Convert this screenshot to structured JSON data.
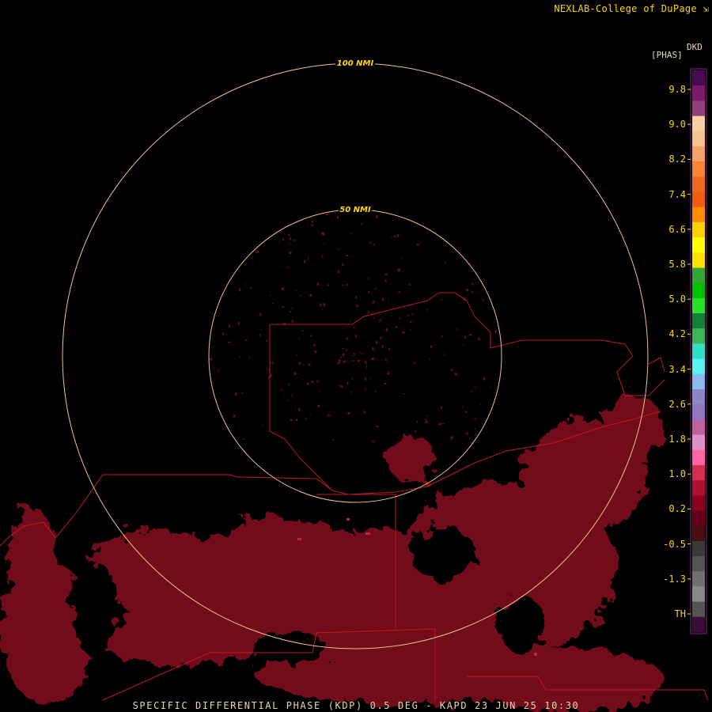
{
  "header": {
    "credit": "NEXLAB-College of DuPage"
  },
  "product": {
    "code": "DKD",
    "unit": "[PHAS]"
  },
  "range_rings": [
    {
      "label": "100 NMI"
    },
    {
      "label": "50 NMI"
    }
  ],
  "legend": {
    "ticks": [
      "9.8",
      "9.0",
      "8.2",
      "7.4",
      "6.6",
      "5.8",
      "5.0",
      "4.2",
      "3.4",
      "2.6",
      "1.8",
      "1.0",
      "0.2",
      "-0.5",
      "-1.3",
      "TH"
    ],
    "colors": [
      "#4b0a55",
      "#7d1a6e",
      "#93407e",
      "#f7d0a2",
      "#f7c294",
      "#f5a26a",
      "#f78534",
      "#f0691c",
      "#ee5d0d",
      "#ff8c00",
      "#ffd000",
      "#ffff00",
      "#ffe000",
      "#34a633",
      "#00c000",
      "#28e028",
      "#12803a",
      "#3cb45a",
      "#2fe0c8",
      "#59f2f2",
      "#89b9ee",
      "#8a86c8",
      "#9078c0",
      "#c060a0",
      "#e090c8",
      "#ff66a6",
      "#d62e50",
      "#b01030",
      "#8c0020",
      "#6a0018",
      "#4a0f12",
      "#3a3a3a",
      "#555555",
      "#707070",
      "#8a8a8a",
      "#555555",
      "#3c0c3c"
    ]
  },
  "footer": {
    "caption": "SPECIFIC DIFFERENTIAL PHASE (KDP) 0.5 DEG - KAPD 23 JUN 25 10:30"
  }
}
